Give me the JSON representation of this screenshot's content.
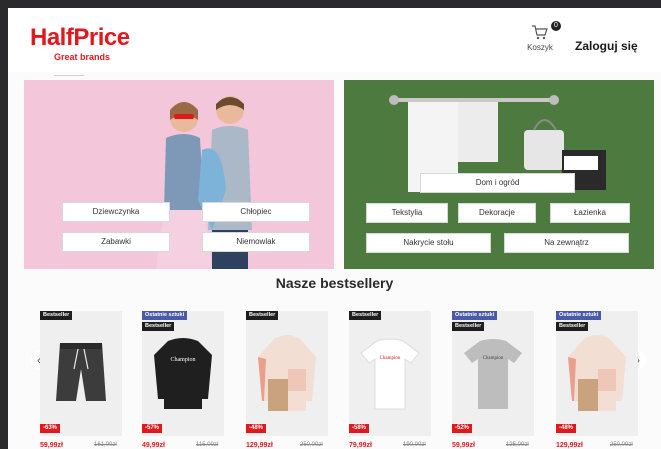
{
  "header": {
    "logo_main": "HalfPrice",
    "logo_sub": "Great brands",
    "cart_count": "0",
    "cart_label": "Koszyk",
    "login_label": "Zaloguj się"
  },
  "banners": {
    "left": {
      "categories": [
        "Dziewczynka",
        "Chłopiec",
        "Zabawki",
        "Niemowlak"
      ]
    },
    "right": {
      "categories": [
        "Dom i ogród",
        "Tekstylia",
        "Dekoracje",
        "Łazienka",
        "Nakrycie stołu",
        "Na zewnątrz"
      ]
    }
  },
  "bestsellers": {
    "title": "Nasze bestsellery",
    "prev_icon": "chevron-left-icon",
    "next_icon": "chevron-right-icon",
    "products": [
      {
        "tags": [
          "Bestseller"
        ],
        "discount": "-63%",
        "price": "59,99zł",
        "old_price": "161,00zł",
        "item": "shorts"
      },
      {
        "tags": [
          "Ostatnie sztuki",
          "Bestseller"
        ],
        "discount": "-57%",
        "price": "49,99zł",
        "old_price": "115,00zł",
        "item": "sweatshirt"
      },
      {
        "tags": [
          "Bestseller"
        ],
        "discount": "-48%",
        "price": "129,99zł",
        "old_price": "250,00zł",
        "item": "hoodie"
      },
      {
        "tags": [
          "Bestseller"
        ],
        "discount": "-58%",
        "price": "79,99zł",
        "old_price": "190,00zł",
        "item": "tshirt-white"
      },
      {
        "tags": [
          "Ostatnie sztuki",
          "Bestseller"
        ],
        "discount": "-52%",
        "price": "59,99zł",
        "old_price": "125,00zł",
        "item": "tshirt-grey"
      },
      {
        "tags": [
          "Ostatnie sztuki",
          "Bestseller"
        ],
        "discount": "-48%",
        "price": "129,99zł",
        "old_price": "250,00zł",
        "item": "hoodie"
      }
    ]
  },
  "colors": {
    "brand_red": "#e0191f",
    "tag_blue": "#4a5aa8",
    "pink_banner": "#f3c6d9",
    "green_banner": "#4d7a3e"
  }
}
